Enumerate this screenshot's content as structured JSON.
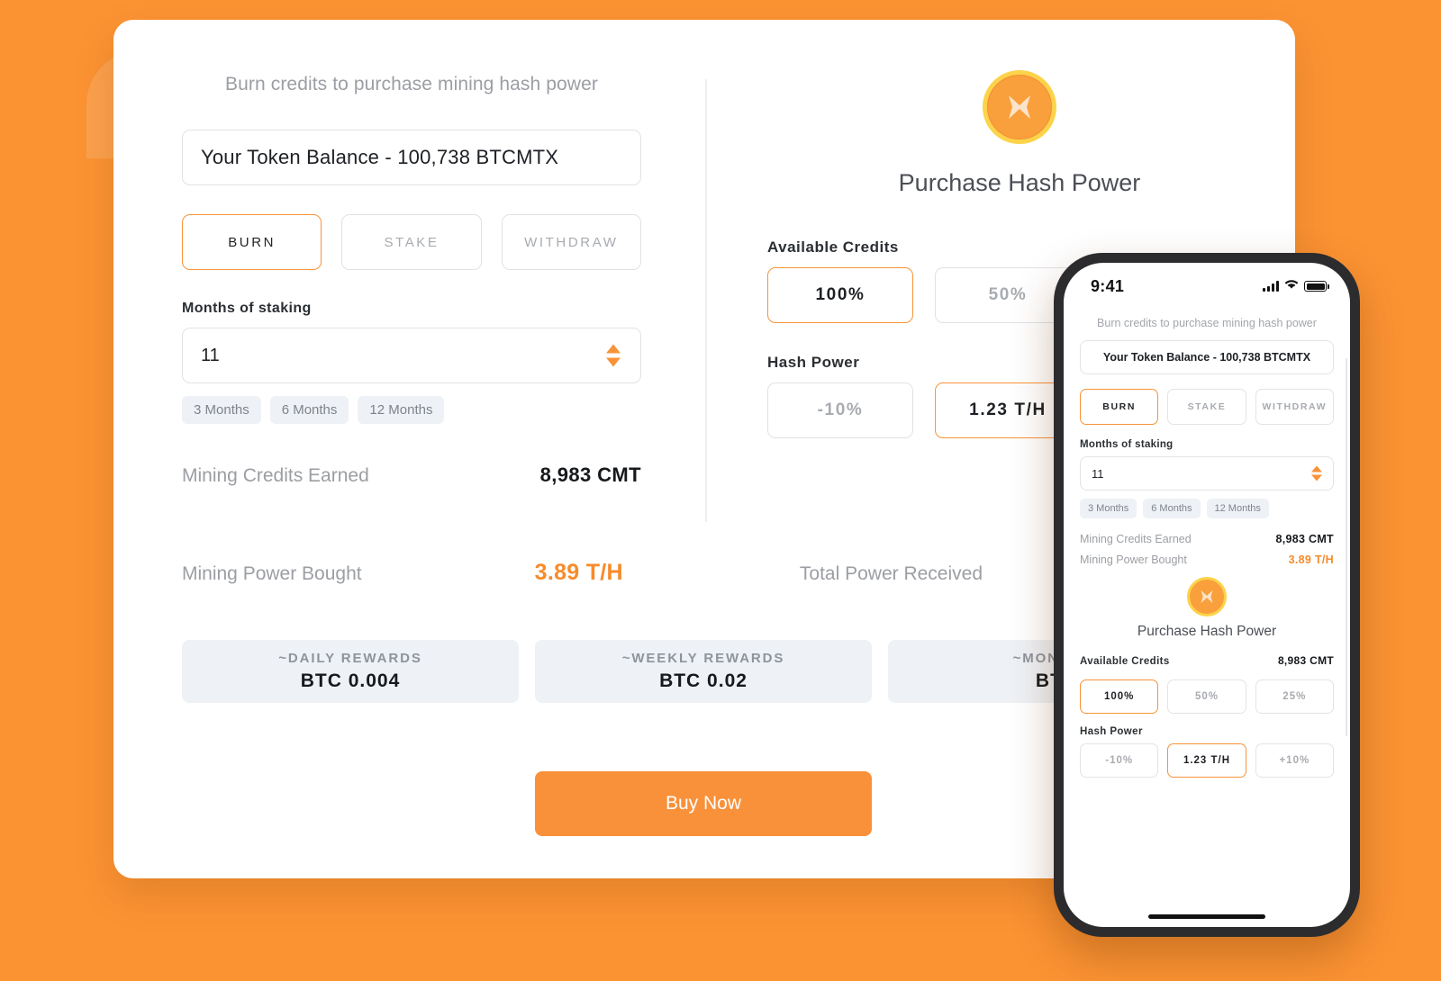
{
  "theme": {
    "background": "#fb9333",
    "accent": "#f89338",
    "card_bg": "#ffffff",
    "muted_text": "#9b9ea3",
    "pill_bg": "#eef1f5"
  },
  "desktop": {
    "subtitle": "Burn credits to purchase mining hash power",
    "balance_value": "Your Token Balance - 100,738 BTCMTX",
    "actions": [
      {
        "label": "BURN",
        "active": true
      },
      {
        "label": "STAKE",
        "active": false
      },
      {
        "label": "WITHDRAW",
        "active": false
      }
    ],
    "months_label": "Months of staking",
    "months_value": "11",
    "month_presets": [
      "3 Months",
      "6 Months",
      "12 Months"
    ],
    "credits_earned_label": "Mining Credits Earned",
    "credits_earned_value": "8,983 CMT",
    "panel": {
      "title": "Purchase Hash Power",
      "logo_icon": "btcmtx-coin-icon",
      "available_credits_label": "Available Credits",
      "credit_options": [
        {
          "label": "100%",
          "active": true
        },
        {
          "label": "50%",
          "active": false
        }
      ],
      "hash_power_label": "Hash Power",
      "hash_options": [
        {
          "label": "-10%",
          "active": false
        },
        {
          "label": "1.23 T/H",
          "active": true
        }
      ]
    },
    "power_bought_label": "Mining Power Bought",
    "power_bought_value": "3.89 T/H",
    "total_power_label": "Total Power Received",
    "rewards": [
      {
        "head": "~DAILY REWARDS",
        "value": "BTC 0.004"
      },
      {
        "head": "~WEEKLY REWARDS",
        "value": "BTC 0.02"
      },
      {
        "head": "~MONTHLY",
        "value": "BTC"
      }
    ],
    "buy_button": "Buy Now"
  },
  "phone": {
    "status": {
      "time": "9:41",
      "signal_icon": "cellular-bars-icon",
      "wifi_icon": "wifi-icon",
      "battery_icon": "battery-full-icon"
    },
    "subtitle": "Burn credits to purchase mining hash power",
    "balance_value": "Your Token Balance - 100,738 BTCMTX",
    "actions": [
      {
        "label": "BURN",
        "active": true
      },
      {
        "label": "STAKE",
        "active": false
      },
      {
        "label": "WITHDRAW",
        "active": false
      }
    ],
    "months_label": "Months of staking",
    "months_value": "11",
    "month_presets": [
      "3 Months",
      "6 Months",
      "12 Months"
    ],
    "credits_earned_label": "Mining Credits Earned",
    "credits_earned_value": "8,983 CMT",
    "power_bought_label": "Mining Power Bought",
    "power_bought_value": "3.89 T/H",
    "panel": {
      "title": "Purchase Hash Power",
      "logo_icon": "btcmtx-coin-icon",
      "available_credits_label": "Available Credits",
      "available_credits_value": "8,983 CMT",
      "credit_options": [
        {
          "label": "100%",
          "active": true
        },
        {
          "label": "50%",
          "active": false
        },
        {
          "label": "25%",
          "active": false
        }
      ],
      "hash_power_label": "Hash Power",
      "hash_options": [
        {
          "label": "-10%",
          "active": false
        },
        {
          "label": "1.23 T/H",
          "active": true
        },
        {
          "label": "+10%",
          "active": false
        }
      ]
    }
  }
}
